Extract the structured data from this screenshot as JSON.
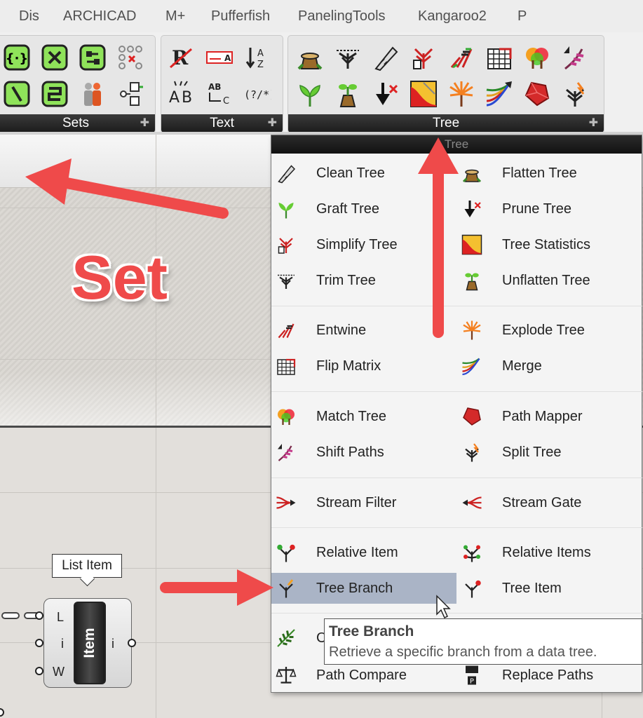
{
  "tabs": [
    "Dis",
    "ARCHICAD",
    "M+",
    "Pufferfish",
    "PanelingTools",
    "Kangaroo2",
    "P"
  ],
  "panels": {
    "sets": "Sets",
    "text": "Text",
    "tree": "Tree"
  },
  "dropdown_header": "Tree",
  "menu_items": [
    {
      "label": "Clean Tree",
      "icon": "clean-tree-icon"
    },
    {
      "label": "Flatten Tree",
      "icon": "flatten-tree-icon"
    },
    {
      "label": "Graft Tree",
      "icon": "graft-tree-icon"
    },
    {
      "label": "Prune Tree",
      "icon": "prune-tree-icon"
    },
    {
      "label": "Simplify Tree",
      "icon": "simplify-tree-icon"
    },
    {
      "label": "Tree Statistics",
      "icon": "tree-statistics-icon"
    },
    {
      "label": "Trim Tree",
      "icon": "trim-tree-icon"
    },
    {
      "label": "Unflatten Tree",
      "icon": "unflatten-tree-icon"
    },
    {
      "label": "Entwine",
      "icon": "entwine-icon"
    },
    {
      "label": "Explode Tree",
      "icon": "explode-tree-icon"
    },
    {
      "label": "Flip Matrix",
      "icon": "flip-matrix-icon"
    },
    {
      "label": "Merge",
      "icon": "merge-icon"
    },
    {
      "label": "Match Tree",
      "icon": "match-tree-icon"
    },
    {
      "label": "Path Mapper",
      "icon": "path-mapper-icon"
    },
    {
      "label": "Shift Paths",
      "icon": "shift-paths-icon"
    },
    {
      "label": "Split Tree",
      "icon": "split-tree-icon"
    },
    {
      "label": "Stream Filter",
      "icon": "stream-filter-icon"
    },
    {
      "label": "Stream Gate",
      "icon": "stream-gate-icon"
    },
    {
      "label": "Relative Item",
      "icon": "relative-item-icon"
    },
    {
      "label": "Relative Items",
      "icon": "relative-items-icon"
    },
    {
      "label": "Tree Branch",
      "icon": "tree-branch-icon"
    },
    {
      "label": "Tree Item",
      "icon": "tree-item-icon"
    },
    {
      "label": "C",
      "icon": "construct-path-icon"
    },
    {
      "label": "Path Compare",
      "icon": "path-compare-icon"
    },
    {
      "label": "Replace Paths",
      "icon": "replace-paths-icon"
    }
  ],
  "tooltip": {
    "title": "Tree Branch",
    "description": "Retrieve a specific branch from a data tree."
  },
  "annotation": "Set",
  "component": {
    "tooltip": "List Item",
    "name": "Item",
    "inputs": [
      "L",
      "i",
      "W"
    ],
    "output": "i"
  },
  "colors": {
    "accent_red": "#ef4a4a",
    "highlight": "#aab4c6",
    "panel_footer": "#1c1c1c"
  }
}
